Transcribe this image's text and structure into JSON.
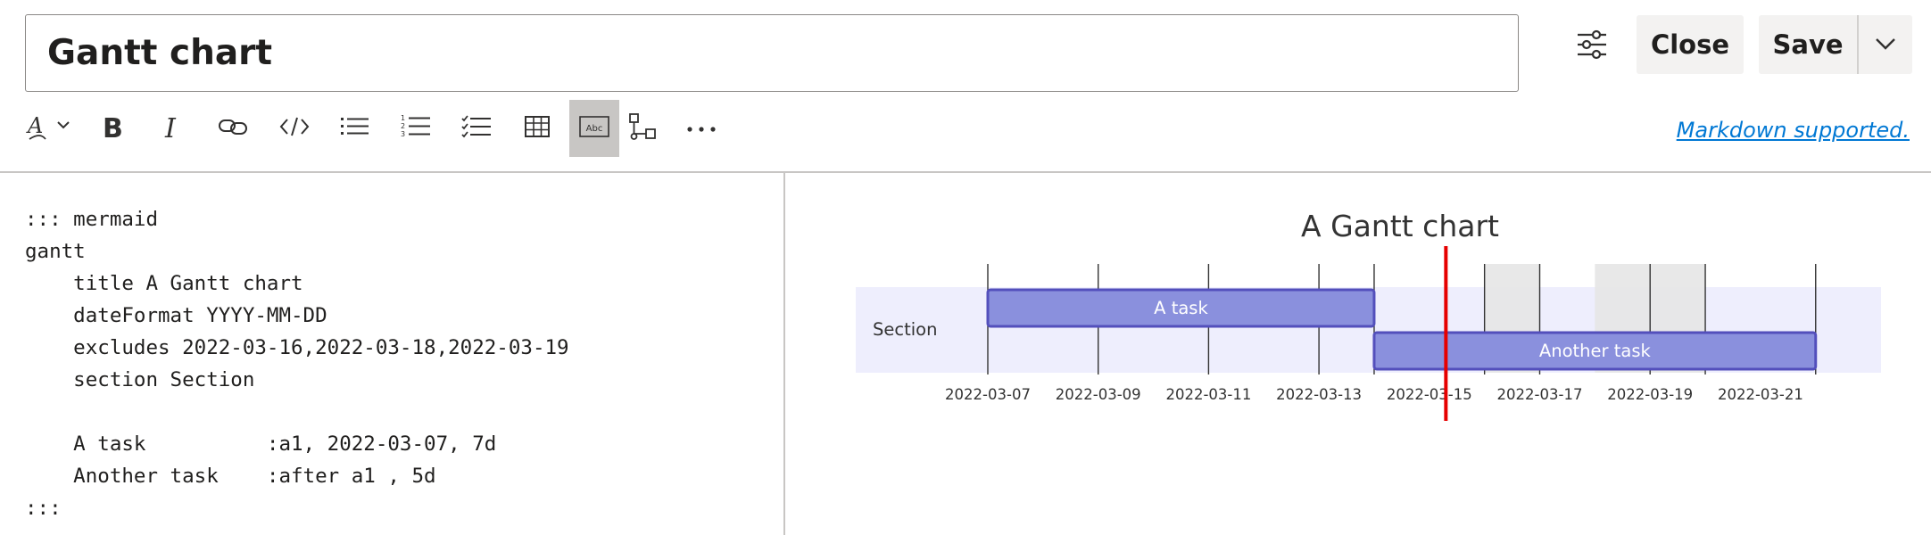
{
  "header": {
    "title_value": "Gantt chart",
    "close_label": "Close",
    "save_label": "Save"
  },
  "toolbar": {
    "items": [
      "text-style-icon",
      "bold-icon",
      "italic-icon",
      "link-icon",
      "code-icon",
      "bulleted-list-icon",
      "numbered-list-icon",
      "checklist-icon",
      "table-icon",
      "abc-code-block-icon",
      "diagram-icon",
      "more-icon"
    ],
    "abc_label": "Abc",
    "markdown_link": "Markdown supported."
  },
  "editor": {
    "lines": [
      "::: mermaid",
      "gantt",
      "    title A Gantt chart",
      "    dateFormat YYYY-MM-DD",
      "    excludes 2022-03-16,2022-03-18,2022-03-19",
      "    section Section",
      "",
      "    A task          :a1, 2022-03-07, 7d",
      "    Another task    :after a1 , 5d",
      ":::"
    ]
  },
  "chart_data": {
    "type": "gantt",
    "title": "A Gantt chart",
    "section": "Section",
    "x_start": "2022-03-05",
    "x_ticks": [
      "2022-03-07",
      "2022-03-09",
      "2022-03-11",
      "2022-03-13",
      "2022-03-15",
      "2022-03-17",
      "2022-03-19",
      "2022-03-21"
    ],
    "excluded_days": [
      "2022-03-16",
      "2022-03-18",
      "2022-03-19"
    ],
    "tasks": [
      {
        "name": "A task",
        "start": "2022-03-07",
        "end": "2022-03-14"
      },
      {
        "name": "Another task",
        "start": "2022-03-14",
        "end": "2022-03-22"
      }
    ],
    "today": "2022-03-15",
    "colors": {
      "task_fill": "#8a90dd",
      "task_stroke": "#534fbc",
      "section_band": "#eeeefd",
      "excluded": "#e6e6e6",
      "today": "#e60000",
      "grid": "#333333"
    }
  }
}
